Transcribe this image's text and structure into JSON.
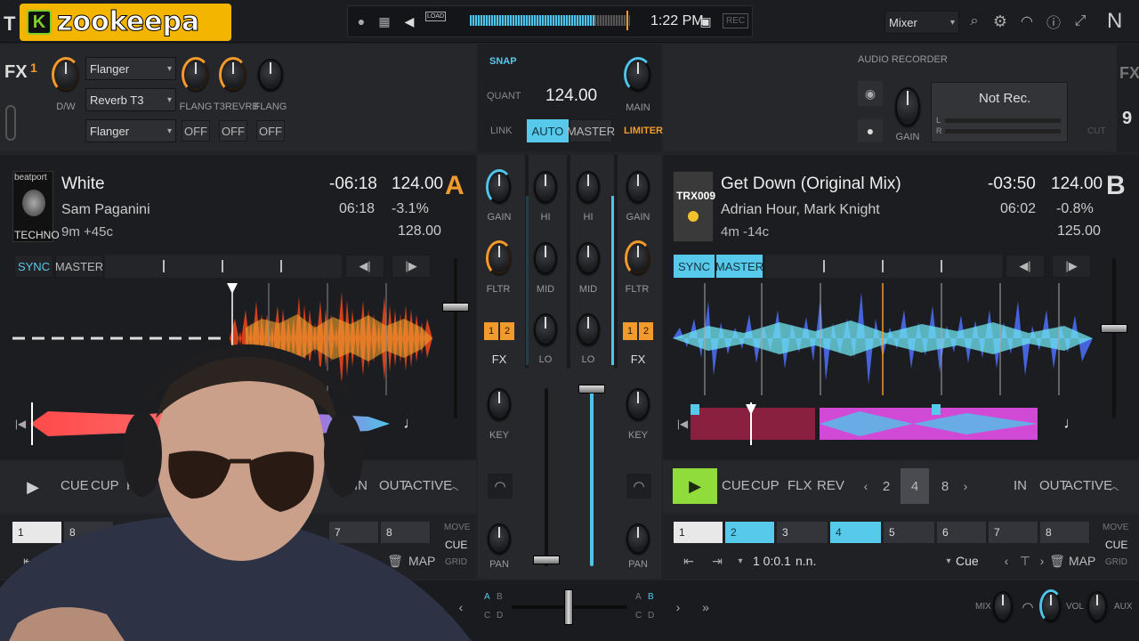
{
  "overlay": {
    "brand_letter": "K",
    "brand_name": "zookeepa",
    "leftmost_char": "T"
  },
  "topbar": {
    "time": "1:22 PM",
    "rec_label": "REC",
    "load_label": "LOAD",
    "layout_select": "Mixer",
    "logo_char": "N"
  },
  "fx": {
    "fx_label": "FX",
    "unit": "1",
    "dw_label": "D/W",
    "selects": [
      "Flanger",
      "Reverb T3",
      "Flanger"
    ],
    "knob_labels": [
      "FLANG",
      "T3REVRB",
      "FLANG"
    ],
    "toggles": [
      "OFF",
      "OFF",
      "OFF"
    ],
    "fx_label_right": "FX",
    "unit_right": "9"
  },
  "master": {
    "snap": "SNAP",
    "quant": "QUANT",
    "bpm": "124.00",
    "link": "LINK",
    "auto": "AUTO",
    "master": "MASTER",
    "main": "MAIN",
    "limiter": "LIMITER"
  },
  "recorder": {
    "title": "AUDIO RECORDER",
    "status": "Not Rec.",
    "gain": "GAIN",
    "l": "L",
    "r": "R",
    "cut": "CUT"
  },
  "deck_a": {
    "letter": "A",
    "art_line1": "beatport",
    "art_line2": "TECHNO",
    "title": "White",
    "artist": "Sam Paganini",
    "length": "9m +45c",
    "remaining": "-06:18",
    "elapsed": "06:18",
    "bpm": "124.00",
    "pitch": "-3.1%",
    "orig_bpm": "128.00",
    "sync": "SYNC",
    "master": "MASTER",
    "cue": "CUE",
    "cup": "CUP",
    "flx": "FLX",
    "in": "IN",
    "out": "OUT",
    "active": "ACTIVE",
    "hotcues": [
      "1",
      "8",
      "7",
      "8"
    ],
    "move": "MOVE",
    "move_cue": "CUE",
    "grid": "GRID",
    "map": "MAP"
  },
  "deck_b": {
    "letter": "B",
    "art_label": "TRX009",
    "title": "Get Down (Original Mix)",
    "artist": "Adrian Hour, Mark Knight",
    "length": "4m -14c",
    "remaining": "-03:50",
    "elapsed": "06:02",
    "bpm": "124.00",
    "pitch": "-0.8%",
    "orig_bpm": "125.00",
    "sync": "SYNC",
    "master": "MASTER",
    "cue": "CUE",
    "cup": "CUP",
    "flx": "FLX",
    "rev": "REV",
    "loops": [
      "2",
      "4",
      "8"
    ],
    "in": "IN",
    "out": "OUT",
    "active": "ACTIVE",
    "hotcues": [
      "1",
      "2",
      "3",
      "4",
      "5",
      "6",
      "7",
      "8"
    ],
    "position": "1 0:0.1",
    "nn": "n.n.",
    "cue_select": "Cue",
    "move": "MOVE",
    "move_cue": "CUE",
    "grid": "GRID",
    "map": "MAP"
  },
  "mixer": {
    "gain": "GAIN",
    "hi": "HI",
    "mid": "MID",
    "lo": "LO",
    "fltr": "FLTR",
    "fx": "FX",
    "key": "KEY",
    "pan": "PAN",
    "fx_buttons": [
      "1",
      "2"
    ],
    "xfader_left": [
      "A",
      "B",
      "C",
      "D"
    ],
    "xfader_right": [
      "A",
      "B",
      "C",
      "D"
    ],
    "mix": "MIX",
    "vol": "VOL",
    "aux": "AUX"
  },
  "colors": {
    "cyan": "#57c9ea",
    "orange": "#f39a2d",
    "play_green": "#8fdc3a"
  }
}
